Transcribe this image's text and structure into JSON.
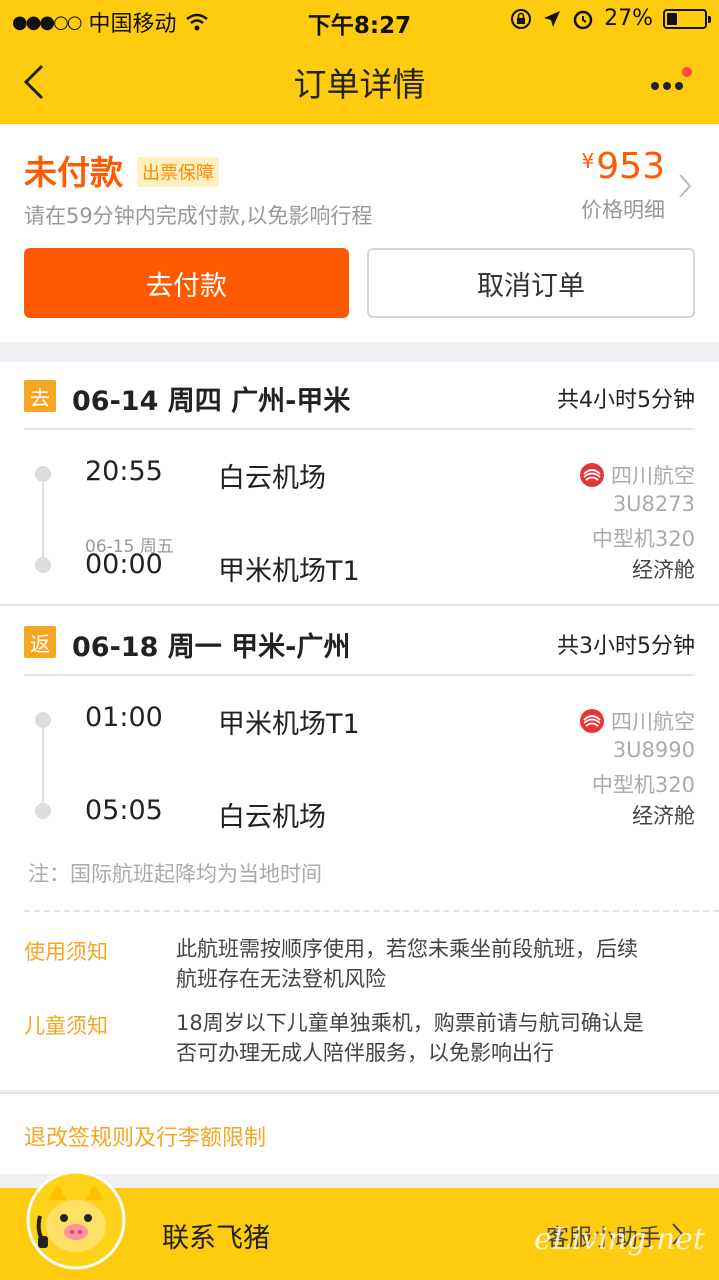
{
  "status_bar": {
    "signal": "●●●○○",
    "carrier": "中国移动",
    "time": "下午8:27",
    "battery_percent": "27%",
    "battery_level": 0.27
  },
  "nav": {
    "title": "订单详情"
  },
  "order": {
    "status": "未付款",
    "guarantee_badge": "出票保障",
    "hint": "请在59分钟内完成付款,以免影响行程",
    "currency": "¥",
    "price": "953",
    "price_detail": "价格明细",
    "pay_button": "去付款",
    "cancel_button": "取消订单"
  },
  "segments": [
    {
      "tag": "去",
      "title": "06-14 周四 广州-甲米",
      "duration": "共4小时5分钟",
      "depart_time": "20:55",
      "depart_airport": "白云机场",
      "arrive_date_note": "06-15 周五",
      "arrive_time": "00:00",
      "arrive_airport": "甲米机场T1",
      "airline": "四川航空",
      "flight_no": "3U8273",
      "aircraft": "中型机320",
      "cabin": "经济舱"
    },
    {
      "tag": "返",
      "title": "06-18 周一 甲米-广州",
      "duration": "共3小时5分钟",
      "depart_time": "01:00",
      "depart_airport": "甲米机场T1",
      "arrive_time": "05:05",
      "arrive_airport": "白云机场",
      "airline": "四川航空",
      "flight_no": "3U8990",
      "aircraft": "中型机320",
      "cabin": "经济舱"
    }
  ],
  "note": "注：国际航班起降均为当地时间",
  "rules": [
    {
      "label": "使用须知",
      "line1": "此航班需按顺序使用，若您未乘坐前段航班，后续",
      "line2": "航班存在无法登机风险"
    },
    {
      "label": "儿童须知",
      "line1": "18周岁以下儿童单独乘机，购票前请与航司确认是",
      "line2": "否可办理无成人陪伴服务，以免影响出行"
    }
  ],
  "refund_link": "退改签规则及行李额限制",
  "bottom": {
    "contact": "联系飞猪",
    "assistant": "客服小助手",
    "watermark": "eLiving.net"
  },
  "colors": {
    "header_yellow": "#ffcb0f",
    "accent_orange": "#ff5a00",
    "label_orange": "#f5a623"
  }
}
